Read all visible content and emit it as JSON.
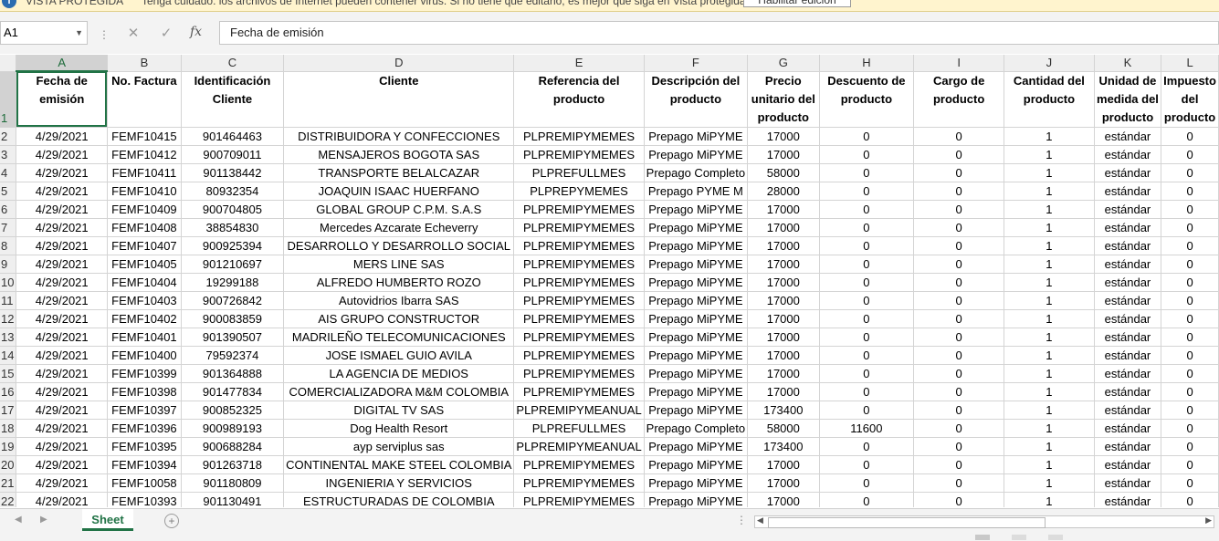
{
  "protected_view": {
    "title": "VISTA PROTEGIDA",
    "message": "Tenga cuidado: los archivos de Internet pueden contener virus. Si no tiene que editarlo, es mejor que siga en Vista protegida.",
    "button": "Habilitar edición"
  },
  "formula_bar": {
    "name_box": "A1",
    "fx": "fx",
    "cancel": "✕",
    "enter": "✓",
    "content": "Fecha de emisión"
  },
  "columns": [
    "A",
    "B",
    "C",
    "D",
    "E",
    "F",
    "G",
    "H",
    "I",
    "J",
    "K",
    "L"
  ],
  "header_row": {
    "number": "1",
    "cells": [
      "Fecha de emisión",
      "No. Factura",
      "Identificación Cliente",
      "Cliente",
      "Referencia del producto",
      "Descripción del producto",
      "Precio unitario del producto",
      "Descuento de producto",
      "Cargo de producto",
      "Cantidad del producto",
      "Unidad de medida del producto",
      "Impuesto del producto"
    ]
  },
  "rows": [
    {
      "n": "2",
      "c": [
        "4/29/2021",
        "FEMF10415",
        "901464463",
        "DISTRIBUIDORA Y CONFECCIONES",
        "PLPREMIPYMEMES",
        "Prepago MiPYME",
        "17000",
        "0",
        "0",
        "1",
        "estándar",
        "0"
      ]
    },
    {
      "n": "3",
      "c": [
        "4/29/2021",
        "FEMF10412",
        "900709011",
        "MENSAJEROS BOGOTA SAS",
        "PLPREMIPYMEMES",
        "Prepago MiPYME",
        "17000",
        "0",
        "0",
        "1",
        "estándar",
        "0"
      ]
    },
    {
      "n": "4",
      "c": [
        "4/29/2021",
        "FEMF10411",
        "901138442",
        "TRANSPORTE BELALCAZAR",
        "PLPREFULLMES",
        "Prepago Completo",
        "58000",
        "0",
        "0",
        "1",
        "estándar",
        "0"
      ]
    },
    {
      "n": "5",
      "c": [
        "4/29/2021",
        "FEMF10410",
        "80932354",
        "JOAQUIN ISAAC HUERFANO",
        "PLPREPYMEMES",
        "Prepago PYME M",
        "28000",
        "0",
        "0",
        "1",
        "estándar",
        "0"
      ]
    },
    {
      "n": "6",
      "c": [
        "4/29/2021",
        "FEMF10409",
        "900704805",
        "GLOBAL GROUP C.P.M. S.A.S",
        "PLPREMIPYMEMES",
        "Prepago MiPYME",
        "17000",
        "0",
        "0",
        "1",
        "estándar",
        "0"
      ]
    },
    {
      "n": "7",
      "c": [
        "4/29/2021",
        "FEMF10408",
        "38854830",
        "Mercedes Azcarate Echeverry",
        "PLPREMIPYMEMES",
        "Prepago MiPYME",
        "17000",
        "0",
        "0",
        "1",
        "estándar",
        "0"
      ]
    },
    {
      "n": "8",
      "c": [
        "4/29/2021",
        "FEMF10407",
        "900925394",
        "DESARROLLO Y DESARROLLO SOCIAL",
        "PLPREMIPYMEMES",
        "Prepago MiPYME",
        "17000",
        "0",
        "0",
        "1",
        "estándar",
        "0"
      ]
    },
    {
      "n": "9",
      "c": [
        "4/29/2021",
        "FEMF10405",
        "901210697",
        "MERS LINE SAS",
        "PLPREMIPYMEMES",
        "Prepago MiPYME",
        "17000",
        "0",
        "0",
        "1",
        "estándar",
        "0"
      ]
    },
    {
      "n": "10",
      "c": [
        "4/29/2021",
        "FEMF10404",
        "19299188",
        "ALFREDO HUMBERTO ROZO",
        "PLPREMIPYMEMES",
        "Prepago MiPYME",
        "17000",
        "0",
        "0",
        "1",
        "estándar",
        "0"
      ]
    },
    {
      "n": "11",
      "c": [
        "4/29/2021",
        "FEMF10403",
        "900726842",
        "Autovidrios Ibarra SAS",
        "PLPREMIPYMEMES",
        "Prepago MiPYME",
        "17000",
        "0",
        "0",
        "1",
        "estándar",
        "0"
      ]
    },
    {
      "n": "12",
      "c": [
        "4/29/2021",
        "FEMF10402",
        "900083859",
        "AIS GRUPO CONSTRUCTOR",
        "PLPREMIPYMEMES",
        "Prepago MiPYME",
        "17000",
        "0",
        "0",
        "1",
        "estándar",
        "0"
      ]
    },
    {
      "n": "13",
      "c": [
        "4/29/2021",
        "FEMF10401",
        "901390507",
        "MADRILEÑO TELECOMUNICACIONES",
        "PLPREMIPYMEMES",
        "Prepago MiPYME",
        "17000",
        "0",
        "0",
        "1",
        "estándar",
        "0"
      ]
    },
    {
      "n": "14",
      "c": [
        "4/29/2021",
        "FEMF10400",
        "79592374",
        "JOSE ISMAEL GUIO AVILA",
        "PLPREMIPYMEMES",
        "Prepago MiPYME",
        "17000",
        "0",
        "0",
        "1",
        "estándar",
        "0"
      ]
    },
    {
      "n": "15",
      "c": [
        "4/29/2021",
        "FEMF10399",
        "901364888",
        "LA AGENCIA DE MEDIOS",
        "PLPREMIPYMEMES",
        "Prepago MiPYME",
        "17000",
        "0",
        "0",
        "1",
        "estándar",
        "0"
      ]
    },
    {
      "n": "16",
      "c": [
        "4/29/2021",
        "FEMF10398",
        "901477834",
        "COMERCIALIZADORA M&M COLOMBIA",
        "PLPREMIPYMEMES",
        "Prepago MiPYME",
        "17000",
        "0",
        "0",
        "1",
        "estándar",
        "0"
      ]
    },
    {
      "n": "17",
      "c": [
        "4/29/2021",
        "FEMF10397",
        "900852325",
        "DIGITAL TV SAS",
        "PLPREMIPYMEANUAL",
        "Prepago MiPYME",
        "173400",
        "0",
        "0",
        "1",
        "estándar",
        "0"
      ]
    },
    {
      "n": "18",
      "c": [
        "4/29/2021",
        "FEMF10396",
        "900989193",
        "Dog Health Resort",
        "PLPREFULLMES",
        "Prepago Completo",
        "58000",
        "11600",
        "0",
        "1",
        "estándar",
        "0"
      ]
    },
    {
      "n": "19",
      "c": [
        "4/29/2021",
        "FEMF10395",
        "900688284",
        "ayp serviplus sas",
        "PLPREMIPYMEANUAL",
        "Prepago MiPYME",
        "173400",
        "0",
        "0",
        "1",
        "estándar",
        "0"
      ]
    },
    {
      "n": "20",
      "c": [
        "4/29/2021",
        "FEMF10394",
        "901263718",
        "CONTINENTAL MAKE STEEL COLOMBIA",
        "PLPREMIPYMEMES",
        "Prepago MiPYME",
        "17000",
        "0",
        "0",
        "1",
        "estándar",
        "0"
      ]
    },
    {
      "n": "21",
      "c": [
        "4/29/2021",
        "FEMF10058",
        "901180809",
        "INGENIERIA Y SERVICIOS",
        "PLPREMIPYMEMES",
        "Prepago MiPYME",
        "17000",
        "0",
        "0",
        "1",
        "estándar",
        "0"
      ]
    },
    {
      "n": "22",
      "c": [
        "4/29/2021",
        "FEMF10393",
        "901130491",
        "ESTRUCTURADAS DE COLOMBIA",
        "PLPREMIPYMEMES",
        "Prepago MiPYME",
        "17000",
        "0",
        "0",
        "1",
        "estándar",
        "0"
      ]
    }
  ],
  "sheet_tabs": [
    "Sheet"
  ],
  "add_sheet": "+",
  "colors": {
    "accent": "#217346",
    "protected_bar": "#fff4ce"
  }
}
